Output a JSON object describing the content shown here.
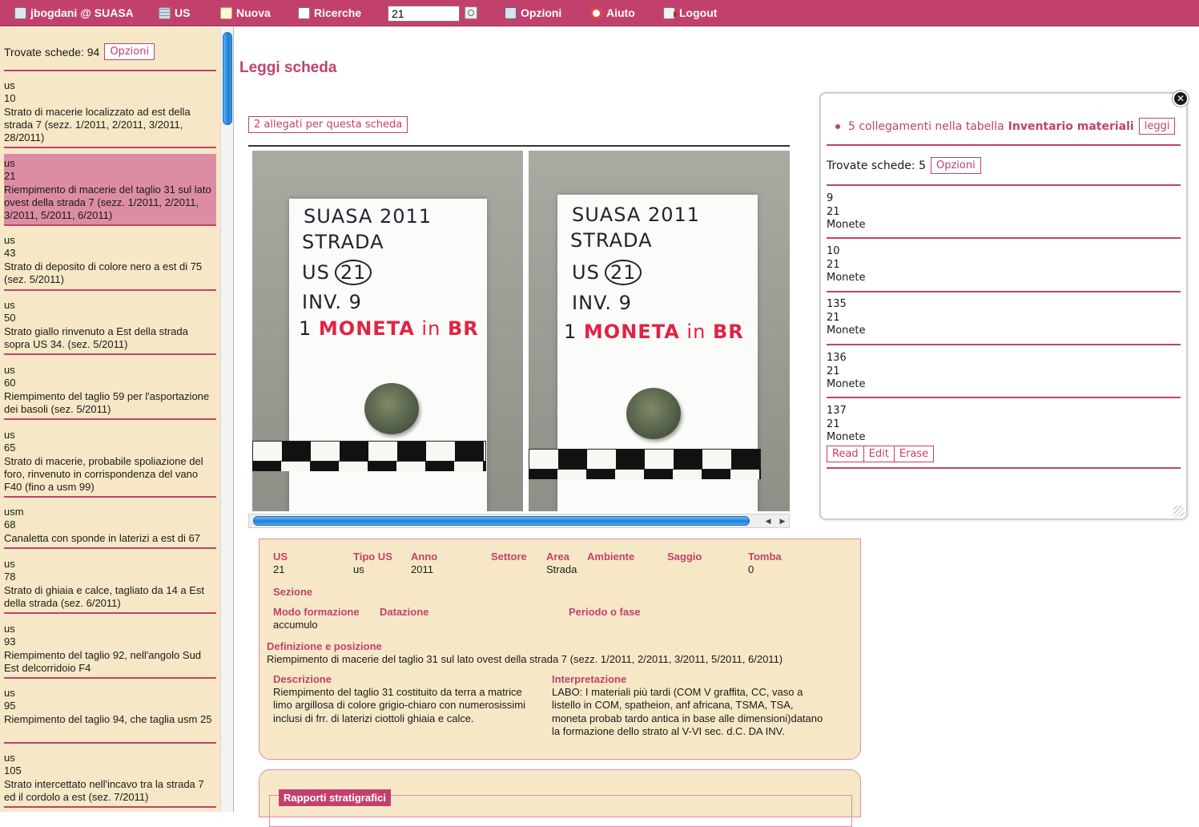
{
  "nav": {
    "user": "jbogdani @ SUASA",
    "us": "US",
    "nuova": "Nuova",
    "ricerche": "Ricerche",
    "search_value": "21",
    "opzioni": "Opzioni",
    "aiuto": "Aiuto",
    "logout": "Logout"
  },
  "sidebar": {
    "found_label": "Trovate schede: 94",
    "options_label": "Opzioni",
    "items": [
      {
        "type": "us",
        "num": "10",
        "desc": "Strato di macerie localizzato ad est della strada 7 (sezz. 1/2011, 2/2011, 3/2011, 28/2011)"
      },
      {
        "type": "us",
        "num": "21",
        "desc": "Riempimento di macerie del taglio 31 sul lato ovest della strada 7 (sezz. 1/2011, 2/2011, 3/2011, 5/2011, 6/2011)"
      },
      {
        "type": "us",
        "num": "43",
        "desc": "Strato di deposito di colore nero a est di 75 (sez. 5/2011)"
      },
      {
        "type": "us",
        "num": "50",
        "desc": "Strato giallo rinvenuto a Est della strada sopra US 34. (sez. 5/2011)"
      },
      {
        "type": "us",
        "num": "60",
        "desc": "Riempimento del taglio 59 per l'asportazione dei basoli (sez. 5/2011)"
      },
      {
        "type": "us",
        "num": "65",
        "desc": "Strato di macerie, probabile spoliazione del foro, rinvenuto in corrispondenza del vano F40 (fino a usm 99)"
      },
      {
        "type": "usm",
        "num": "68",
        "desc": "Canaletta con sponde in laterizi a est di 67"
      },
      {
        "type": "us",
        "num": "78",
        "desc": "Strato di ghiaia e calce, tagliato da 14 a Est della strada (sez. 6/2011)"
      },
      {
        "type": "us",
        "num": "93",
        "desc": "Riempimento del taglio 92, nell'angolo Sud Est delcorridoio F4"
      },
      {
        "type": "us",
        "num": "95",
        "desc": "Riempimento del taglio 94, che taglia usm 25"
      },
      {
        "type": "us",
        "num": "105",
        "desc": "Strato intercettato nell'incavo tra la strada 7 ed il cordolo a est (sez. 7/2011)"
      }
    ]
  },
  "main": {
    "title": "Leggi scheda",
    "attachments_label": "2 allegati per questa scheda",
    "photo": {
      "line1": "SUASA 2011",
      "line2": "STRADA",
      "line3_prefix": "US",
      "line3_num": "21",
      "line4": "INV. 9",
      "line5_a": "1",
      "line5_b": "MONETA",
      "line5_c": "in",
      "line5_d": "BR"
    }
  },
  "detail": {
    "us_label": "US",
    "us_value": "21",
    "tipo_label": "Tipo US",
    "tipo_value": "us",
    "anno_label": "Anno",
    "anno_value": "2011",
    "settore_label": "Settore",
    "area_label": "Area",
    "area_value": "Strada",
    "ambiente_label": "Ambiente",
    "saggio_label": "Saggio",
    "tomba_label": "Tomba",
    "tomba_value": "0",
    "sezione_label": "Sezione",
    "modo_label": "Modo formazione",
    "modo_value": "accumulo",
    "datazione_label": "Datazione",
    "periodo_label": "Periodo o fase",
    "definizione_label": "Definizione e posizione",
    "definizione_value": "Riempimento di macerie del taglio 31 sul lato ovest della strada 7 (sezz. 1/2011, 2/2011, 3/2011, 5/2011, 6/2011)",
    "descrizione_label": "Descrizione",
    "descrizione_value": "Riempimento del taglio 31 costituito da terra a matrice limo argillosa di colore grigio-chiaro con numerosissimi inclusi di frr. di laterizi ciottoli ghiaia e calce.",
    "interpretazione_label": "Interpretazione",
    "interpretazione_value": "LABO: I materiali più tardi (COM V graffita, CC, vaso a listello in COM, spatheion, anf africana, TSMA, TSA, moneta probab tardo antica in base alle dimensioni)datano la formazione dello strato al V-VI sec. d.C. DA INV.",
    "rapporti_label": "Rapporti stratigrafici"
  },
  "popup": {
    "close_glyph": "✕",
    "links_prefix": "5 collegamenti nella tabella",
    "links_table": "Inventario materiali",
    "links_btn": "leggi",
    "found_label": "Trovate schede: 5",
    "options_label": "Opzioni",
    "items": [
      {
        "inv": "9",
        "us": "21",
        "cls": "Monete"
      },
      {
        "inv": "10",
        "us": "21",
        "cls": "Monete"
      },
      {
        "inv": "135",
        "us": "21",
        "cls": "Monete"
      },
      {
        "inv": "136",
        "us": "21",
        "cls": "Monete"
      },
      {
        "inv": "137",
        "us": "21",
        "cls": "Monete"
      }
    ],
    "read_label": "Read",
    "edit_label": "Edit",
    "erase_label": "Erase"
  },
  "colors": {
    "accent": "#c2416c",
    "panel": "#f6e8c7",
    "selected": "#dc8da4"
  }
}
